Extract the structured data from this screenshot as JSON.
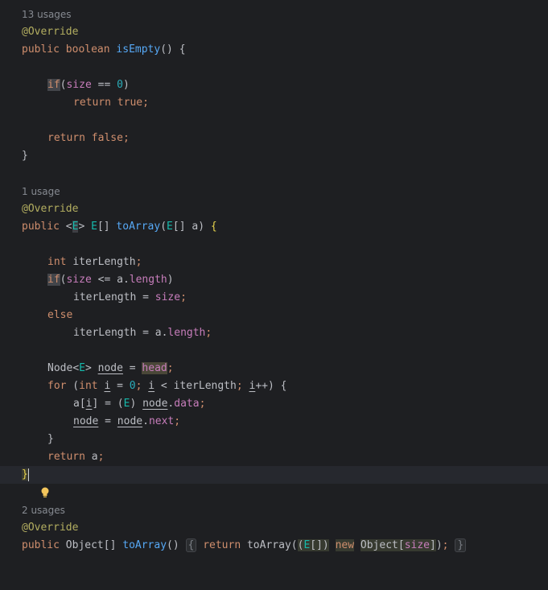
{
  "colors": {
    "background": "#1e1f22",
    "keyword": "#cf8e6d",
    "annotation": "#b3ae60",
    "function": "#56a8f5",
    "field": "#c77dbb",
    "type_param": "#16baac",
    "number": "#2aacb8",
    "text": "#bcbec4",
    "hint": "#868a91"
  },
  "icons": {
    "intention_bulb": "lightbulb-icon"
  },
  "usages": {
    "isEmpty": "13 usages",
    "toArrayGeneric": "1 usage",
    "toArrayObject": "2 usages"
  },
  "tokens": {
    "override": "@Override",
    "public": "public",
    "boolean": "boolean",
    "isEmpty": "isEmpty",
    "if": "if",
    "size": "size",
    "zero": "0",
    "return": "return",
    "true": "true",
    "false": "false",
    "lt": "<",
    "gt": ">",
    "E": "E",
    "toArray": "toArray",
    "int": "int",
    "iterLength": "iterLength",
    "a": "a",
    "length": "length",
    "else": "else",
    "Node": "Node",
    "node": "node",
    "head": "head",
    "for": "for",
    "i": "i",
    "data": "data",
    "next": "next",
    "Object": "Object",
    "new": "new"
  }
}
